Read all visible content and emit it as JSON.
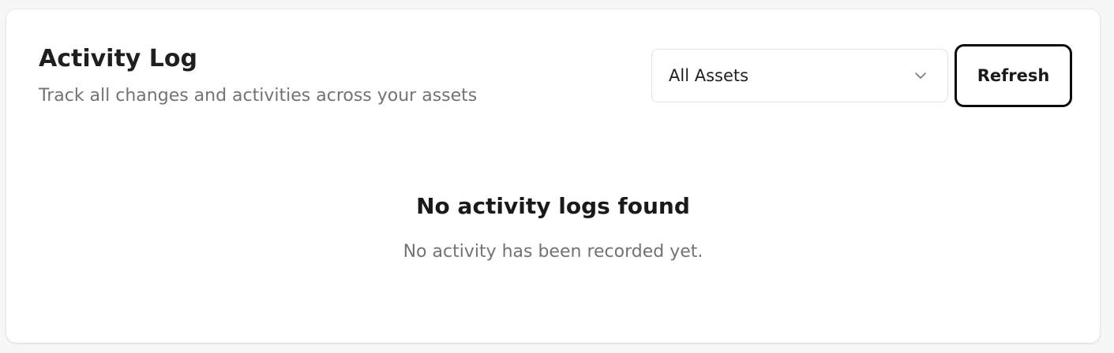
{
  "header": {
    "title": "Activity Log",
    "subtitle": "Track all changes and activities across your assets"
  },
  "filter": {
    "selected": "All Assets",
    "icon": "chevron-down-icon"
  },
  "actions": {
    "refresh_label": "Refresh"
  },
  "empty_state": {
    "title": "No activity logs found",
    "message": "No activity has been recorded yet."
  },
  "colors": {
    "text_primary": "#1f1f1f",
    "text_muted": "#737373",
    "border": "#e3e3e3",
    "button_border": "#0b0b0b"
  }
}
